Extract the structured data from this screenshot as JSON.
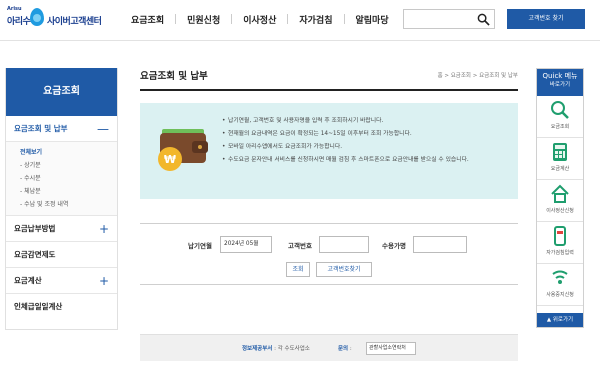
{
  "header": {
    "logo_small": "Arisu",
    "logo_name": "아리수",
    "logo_center": "사이버고객센터",
    "nav": [
      "요금조회",
      "민원신청",
      "이사정산",
      "자가검침",
      "알림마당"
    ],
    "search_value": "",
    "find_button": "고객번호 찾기"
  },
  "sidebar": {
    "title": "요금조회",
    "items": [
      {
        "label": "요금조회 및 납부",
        "toggle": "—"
      },
      {
        "label": "요금납부방법",
        "toggle": "+"
      },
      {
        "label": "요금감면제도",
        "toggle": ""
      },
      {
        "label": "요금계산",
        "toggle": "+"
      },
      {
        "label": "인체급일일계산",
        "toggle": ""
      }
    ],
    "sub_items": [
      "전체보기",
      "- 상기분",
      "- 수시분",
      "- 체납분",
      "- 수납 및 조정 내역"
    ]
  },
  "main": {
    "title": "요금조회 및 납부",
    "breadcrumb": "홈 > 요금조회 > 요금조회 및 납부",
    "notices": [
      "납기연월, 고객번호 및 사용자명을 입력 후 조회하시기 바랍니다.",
      "현재월의 요금내역은 요금이 확정되는 14~15일 이후부터 조회 가능합니다.",
      "모바일 아리수앱에서도 요금조회가 가능합니다.",
      "수도요금 문자안내 서비스를 신청하시면 매월 검침 후 스마트폰으로 요금안내를 받으실 수 있습니다."
    ],
    "form": {
      "date_label": "납기연월",
      "date_value": "2024년 05월",
      "customer_label": "고객번호",
      "customer_value": "",
      "user_label": "수용가명",
      "user_value": "",
      "search_button": "조회",
      "find_button": "고객번호찾기"
    },
    "footer": {
      "info_label": "정보제공부서",
      "info_value": "각 수도사업소",
      "contact_label": "문의",
      "contact_value": "관할사업소연락처"
    }
  },
  "quick": {
    "title": "Quick 메뉴",
    "subtitle": "바로가기",
    "items": [
      "요금조회",
      "요금계산",
      "이사정산신청",
      "자가검침입력",
      "사용중지신청"
    ],
    "footer": "위로가기"
  }
}
